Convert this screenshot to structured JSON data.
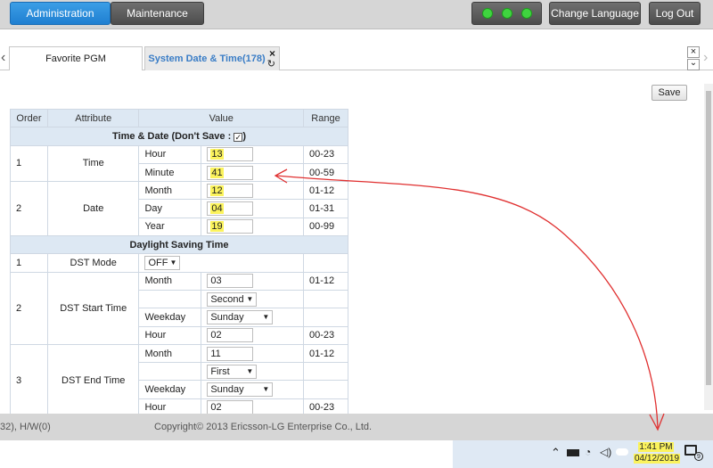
{
  "header": {
    "admin_tab": "Administration",
    "maint_tab": "Maintenance",
    "change_language": "Change Language",
    "logout": "Log Out"
  },
  "tabs": {
    "left_arrow": "‹",
    "right_arrow": "›",
    "favorite": "Favorite PGM",
    "system": "System Date & Time(178)",
    "close": "×",
    "refresh": "↻",
    "close_right": "×",
    "chevron_down": "⌄"
  },
  "save_label": "Save",
  "table": {
    "headers": [
      "Order",
      "Attribute",
      "Value",
      "Range"
    ],
    "section1": "Time & Date (Don't Save :",
    "section1_end": ")",
    "section2": "Daylight Saving Time",
    "time_order": "1",
    "time_attr": "Time",
    "hour_label": "Hour",
    "hour_val": "13",
    "hour_range": "00-23",
    "minute_label": "Minute",
    "minute_val": "41",
    "minute_range": "00-59",
    "date_order": "2",
    "date_attr": "Date",
    "month_label": "Month",
    "month_val": "12",
    "month_range": "01-12",
    "day_label": "Day",
    "day_val": "04",
    "day_range": "01-31",
    "year_label": "Year",
    "year_val": "19",
    "year_range": "00-99",
    "dst_mode_order": "1",
    "dst_mode_attr": "DST Mode",
    "dst_mode_val": "OFF",
    "start_order": "2",
    "start_attr": "DST Start Time",
    "start_month_label": "Month",
    "start_month_val": "03",
    "start_month_range": "01-12",
    "start_week_val": "Second",
    "start_weekday_label": "Weekday",
    "start_weekday_val": "Sunday",
    "start_hour_label": "Hour",
    "start_hour_val": "02",
    "start_hour_range": "00-23",
    "end_order": "3",
    "end_attr": "DST End Time",
    "end_month_label": "Month",
    "end_month_val": "11",
    "end_month_range": "01-12",
    "end_week_val": "First",
    "end_weekday_label": "Weekday",
    "end_weekday_val": "Sunday",
    "end_hour_label": "Hour",
    "end_hour_val": "02",
    "end_hour_range": "00-23"
  },
  "footer": {
    "left": "32), H/W(0)",
    "copyright": "Copyright© 2013 Ericsson-LG Enterprise Co., Ltd."
  },
  "taskbar": {
    "time": "1:41 PM",
    "date": "04/12/2019",
    "notif_count": "9"
  },
  "colors": {
    "accent": "#1f7fd1",
    "highlight": "#fbf35d",
    "annotation": "#e03030",
    "status_green": "#3fd43f"
  }
}
